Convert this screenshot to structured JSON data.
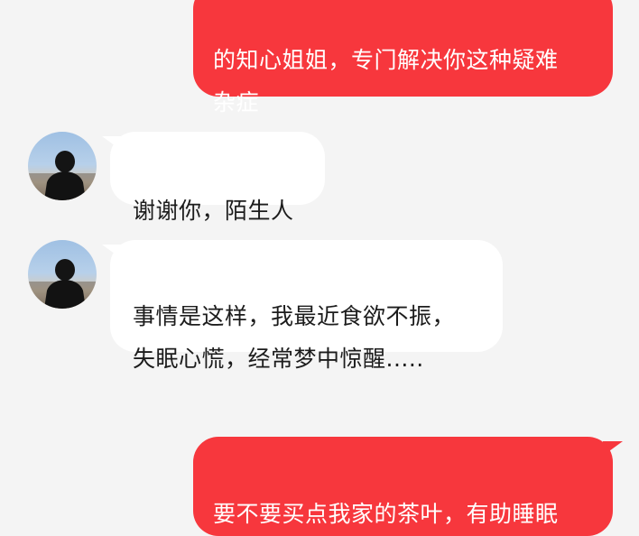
{
  "chat": {
    "messages": [
      {
        "side": "outgoing",
        "text": "的知心姐姐，专门解决你这种疑难\n杂症"
      },
      {
        "side": "incoming",
        "avatar": "person-silhouette-avatar",
        "text": "谢谢你，陌生人"
      },
      {
        "side": "incoming",
        "avatar": "person-silhouette-avatar",
        "text": "事情是这样，我最近食欲不振，\n失眠心慌，经常梦中惊醒....."
      },
      {
        "side": "outgoing",
        "text": "要不要买点我家的茶叶，有助睡眠"
      }
    ]
  },
  "colors": {
    "background": "#f4f4f4",
    "outgoing_bubble": "#f7373d",
    "incoming_bubble": "#ffffff",
    "outgoing_text": "#ffffff",
    "incoming_text": "#1c1c1c"
  }
}
